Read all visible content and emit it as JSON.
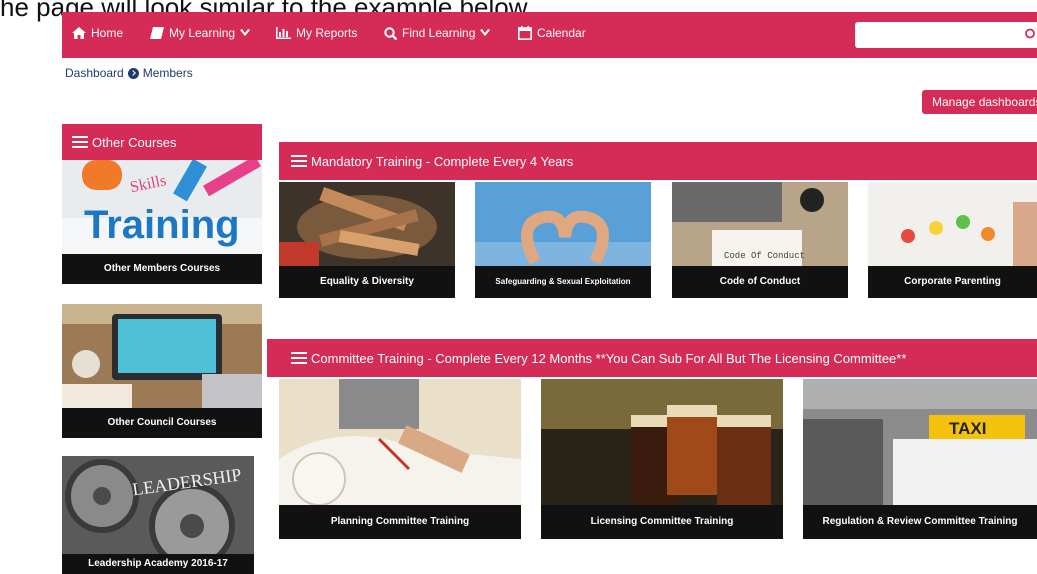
{
  "caption": "he page will look similar to the example below.",
  "nav": {
    "home": "Home",
    "my_learning": "My Learning",
    "my_reports": "My Reports",
    "find_learning": "Find Learning",
    "calendar": "Calendar",
    "search_placeholder": ""
  },
  "breadcrumb": {
    "dashboard": "Dashboard",
    "members": "Members"
  },
  "manage_dashboards": "Manage dashboards",
  "side_block": {
    "title": "Other Courses",
    "tiles": [
      {
        "label": "Other Members Courses",
        "image_text": "Training",
        "image_subtext": "Skills"
      },
      {
        "label": "Other Council Courses"
      },
      {
        "label": "Leadership Academy 2016-17",
        "image_text": "LEADERSHIP"
      }
    ]
  },
  "mandatory": {
    "title": "Mandatory Training - Complete Every 4 Years",
    "tiles": [
      {
        "label": "Equality & Diversity"
      },
      {
        "label": "Safeguarding & Sexual Exploitation"
      },
      {
        "label": "Code of Conduct",
        "image_text": "Code Of Conduct"
      },
      {
        "label": "Corporate Parenting"
      }
    ]
  },
  "committee": {
    "title": "Committee Training - Complete Every 12 Months **You Can Sub For All But The Licensing Committee**",
    "tiles": [
      {
        "label": "Planning Committee Training"
      },
      {
        "label": "Licensing Committee Training"
      },
      {
        "label": "Regulation & Review Committee Training",
        "image_text": "TAXI"
      }
    ]
  },
  "colors": {
    "brand": "#d42b57",
    "label_bg": "#111111",
    "link": "#1f3b6e"
  }
}
